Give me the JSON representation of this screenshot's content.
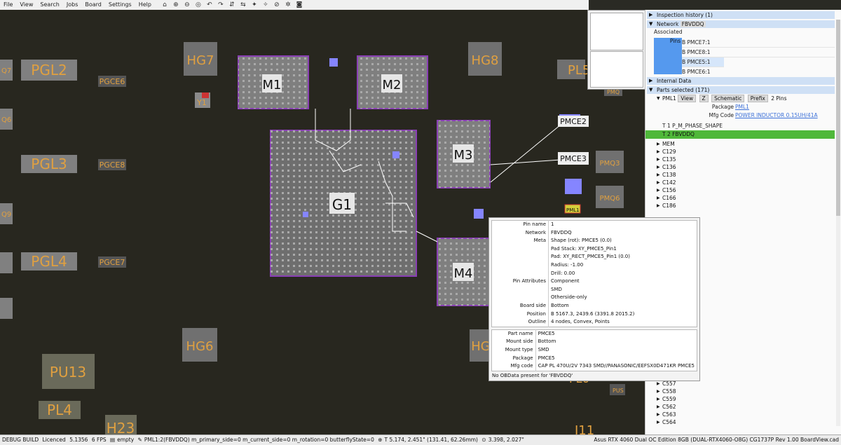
{
  "menu": [
    "File",
    "View",
    "Search",
    "Jobs",
    "Board",
    "Settings",
    "Help"
  ],
  "toolbar_icons": [
    "home-icon",
    "zoom-in-icon",
    "zoom-out-icon",
    "zoom-fit-icon",
    "rotate-left-icon",
    "rotate-right-icon",
    "flip-icon",
    "mirror-icon",
    "highlight-icon",
    "unhighlight-icon",
    "hide-icon",
    "settings-icon",
    "camera-icon"
  ],
  "board": {
    "components": [
      {
        "label": "PGL2"
      },
      {
        "label": "PGL3"
      },
      {
        "label": "PGL4"
      },
      {
        "label": "PU13"
      },
      {
        "label": "PL4"
      },
      {
        "label": "H23"
      },
      {
        "label": "HG7"
      },
      {
        "label": "HG8"
      },
      {
        "label": "HG6"
      },
      {
        "label": "HG"
      },
      {
        "label": "PGCE6"
      },
      {
        "label": "PGCE8"
      },
      {
        "label": "PGCE7"
      },
      {
        "label": "Y1"
      },
      {
        "label": "Q7"
      },
      {
        "label": "Q6"
      },
      {
        "label": "Q9"
      },
      {
        "label": "PL5"
      },
      {
        "label": "PMQ3"
      },
      {
        "label": "PMQ6"
      },
      {
        "label": "PMQ"
      },
      {
        "label": "PL6"
      },
      {
        "label": "J11"
      },
      {
        "label": "PUS"
      },
      {
        "label": "M1"
      },
      {
        "label": "M2"
      },
      {
        "label": "M3"
      },
      {
        "label": "M4"
      },
      {
        "label": "G1"
      },
      {
        "label": "PMCE2"
      },
      {
        "label": "PMCE3"
      },
      {
        "label": "PML1"
      }
    ]
  },
  "side": {
    "inspection_history": "Inspection history (1)",
    "network_label": "Network",
    "network_value": "FBVDDQ",
    "associated_label": "Associated",
    "pins_label": "Pins",
    "pins": [
      "B PMCE7:1",
      "B PMCE8:1",
      "B PMCE5:1",
      "B PMCE6:1"
    ],
    "internal_data": "Internal Data",
    "parts_selected": "Parts selected (171)",
    "pml1": {
      "name": "PML1",
      "view": "View",
      "z": "Z",
      "schematic": "Schematic",
      "prefix": "Prefix",
      "pins_count": "2 Pins"
    },
    "package_label": "Package",
    "package_value": "PML1",
    "mfg_label": "Mfg Code",
    "mfg_value": "POWER INDUCTOR 0.15UH/41A",
    "pin_rows": [
      "T  1  P_M_PHASE_SHAPE",
      "T  2  FBVDDQ"
    ],
    "parts_upper": [
      "MEM",
      "C135",
      "C136",
      "C138",
      "C142",
      "C156",
      "C166",
      "C186"
    ],
    "parts_lower": [
      "C557",
      "C558",
      "C559",
      "C562",
      "C563",
      "C564"
    ],
    "c129": "C129"
  },
  "tooltip": {
    "pin_rows": [
      {
        "k": "Pin name",
        "v": "1"
      },
      {
        "k": "Network",
        "v": "FBVDDQ"
      },
      {
        "k": "Meta",
        "v": "Shape (rot): PMCE5 (0.0)"
      },
      {
        "k": "",
        "v": "Pad Stack: XY_PMCE5_Pin1"
      },
      {
        "k": "",
        "v": "Pad: XY_RECT_PMCE5_Pin1 (0.0)"
      },
      {
        "k": "",
        "v": "Radius: -1.00"
      },
      {
        "k": "",
        "v": "Drill: 0.00"
      },
      {
        "k": "Pin Attributes",
        "v": "Component"
      },
      {
        "k": "",
        "v": "SMD"
      },
      {
        "k": "",
        "v": "Otherside-only"
      },
      {
        "k": "Board side",
        "v": "Bottom"
      },
      {
        "k": "Position",
        "v": "B 5167.3, 2439.6 (3391.8 2015.2)"
      },
      {
        "k": "Outline",
        "v": "4 nodes, Convex, Points"
      }
    ],
    "part_rows": [
      {
        "k": "Part name",
        "v": "PMCE5"
      },
      {
        "k": "Mount side",
        "v": "Bottom"
      },
      {
        "k": "Mount type",
        "v": "SMD"
      },
      {
        "k": "Package",
        "v": "PMCE5"
      },
      {
        "k": "Mfg code",
        "v": "CAP PL 470U/2V 7343 SMD//PANASONIC/EEFSX0D471KR PMCE5"
      }
    ],
    "footer": "No OBData present for 'FBVDDQ'"
  },
  "status": {
    "build": "DEBUG BUILD",
    "licence": "Licenced",
    "version": "5.1356",
    "fps": "6 FPS",
    "file": "empty",
    "selection": "PML1:2(FBVDDQ)  m_primary_side=0  m_current_side=0  m_rotation=0  butterflyState=0",
    "coords1": "T 5.174, 2.451\" (131.41, 62.26mm)",
    "coords2": "3.398, 2.027\"",
    "board_name": "Asus RTX 4060 Dual OC Edition 8GB (DUAL-RTX4060-O8G) CG1737P Rev 1.00 BoardView.cad"
  },
  "colors": {
    "board_bg": "#28271f",
    "label": "#e0a040",
    "selected": "#8a3fb5",
    "highlight": "#8585ff",
    "trace": "#ffffff",
    "pin_selected": "#4fb83a"
  }
}
